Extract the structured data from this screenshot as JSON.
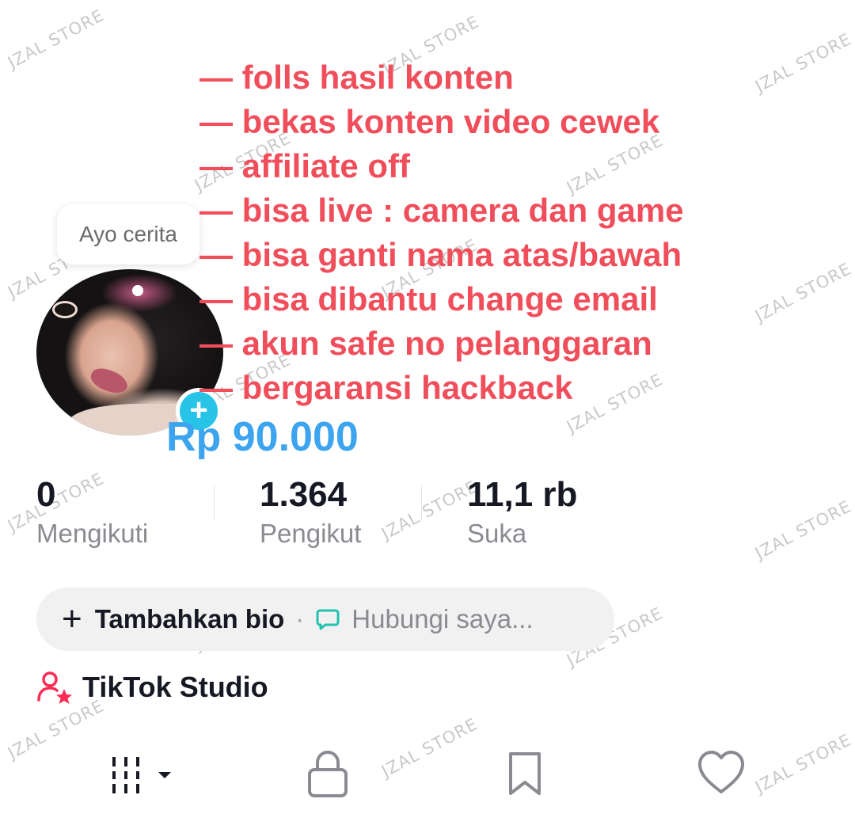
{
  "watermark": "JZAL STORE",
  "avatar": {
    "bubble_text": "Ayo cerita",
    "add_icon": "plus-icon",
    "accent": "#28c4e8"
  },
  "annotation": {
    "color": "#f04e5b",
    "lines": [
      "— folls hasil konten",
      "— bekas konten video cewek",
      "— affiliate off",
      "— bisa live : camera dan game",
      "— bisa ganti nama atas/bawah",
      "— bisa dibantu change email",
      "— akun safe no pelanggaran",
      "— bergaransi hackback"
    ],
    "price": "Rp 90.000",
    "price_color": "#3da4ef"
  },
  "stats": {
    "following": {
      "value": "0",
      "label": "Mengikuti"
    },
    "followers": {
      "value": "1.364",
      "label": "Pengikut"
    },
    "likes": {
      "value": "11,1 rb",
      "label": "Suka"
    }
  },
  "bio": {
    "add_label": "Tambahkan bio",
    "separator": "·",
    "contact_label": "Hubungi saya...",
    "contact_icon": "chat-bubble-icon"
  },
  "studio": {
    "label": "TikTok Studio",
    "icon": "user-star-icon",
    "icon_color": "#fe2c55"
  },
  "tabs": [
    {
      "name": "grid-tab",
      "icon": "grid-dropdown-icon"
    },
    {
      "name": "private-tab",
      "icon": "lock-icon"
    },
    {
      "name": "saved-tab",
      "icon": "bookmark-icon"
    },
    {
      "name": "liked-tab",
      "icon": "heart-icon"
    }
  ]
}
